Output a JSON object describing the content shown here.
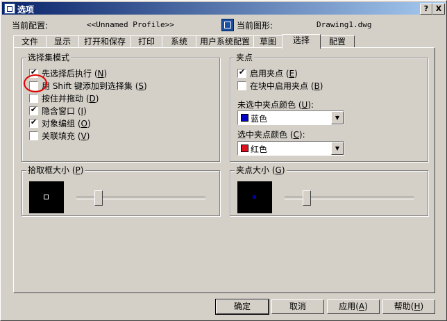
{
  "window": {
    "title": "选项",
    "help_btn": "?",
    "close_btn": "X"
  },
  "header": {
    "current_profile_label": "当前配置:",
    "current_profile_value": "<<Unnamed Profile>>",
    "current_drawing_label": "当前图形:",
    "current_drawing_value": "Drawing1.dwg"
  },
  "tabs": [
    "文件",
    "显示",
    "打开和保存",
    "打印",
    "系统",
    "用户系统配置",
    "草图",
    "选择",
    "配置"
  ],
  "active_tab": "选择",
  "selection_modes": {
    "title": "选择集模式",
    "items": [
      {
        "label": "先选择后执行",
        "key": "N",
        "checked": true
      },
      {
        "label": "用 Shift 键添加到选择集",
        "key": "S",
        "checked": false
      },
      {
        "label": "按住并拖动",
        "key": "D",
        "checked": false
      },
      {
        "label": "隐含窗口",
        "key": "I",
        "checked": true
      },
      {
        "label": "对象编组",
        "key": "O",
        "checked": true
      },
      {
        "label": "关联填充",
        "key": "V",
        "checked": false
      }
    ]
  },
  "grips": {
    "title": "夹点",
    "enable": {
      "label": "启用夹点",
      "key": "E",
      "checked": true
    },
    "in_blocks": {
      "label": "在块中启用夹点",
      "key": "B",
      "checked": false
    },
    "unselected_color_label": "未选中夹点颜色",
    "unselected_color_key": "U",
    "unselected_color": {
      "name": "蓝色",
      "swatch": "#0000c8"
    },
    "selected_color_label": "选中夹点颜色",
    "selected_color_key": "C",
    "selected_color": {
      "name": "红色",
      "swatch": "#e0101e"
    }
  },
  "pickbox": {
    "title": "拾取框大小",
    "key": "P",
    "slider_value": 0.15
  },
  "gripsize": {
    "title": "夹点大小",
    "key": "G",
    "slider_value": 0.15
  },
  "buttons": {
    "ok": "确定",
    "cancel": "取消",
    "apply": "应用",
    "apply_key": "A",
    "help": "帮助",
    "help_key": "H"
  }
}
